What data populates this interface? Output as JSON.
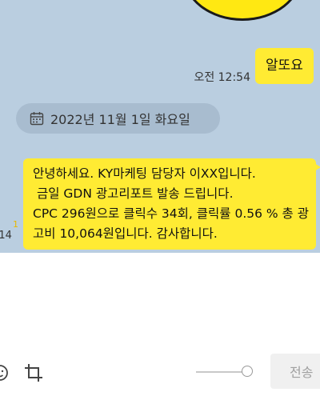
{
  "chat": {
    "messages": [
      {
        "time": "오전 12:54",
        "text": "알또요"
      },
      {
        "unread": "1",
        "time": ":14",
        "text": "안녕하세요. KY마케팅 담당자 이XX입니다.\n 금일 GDN 광고리포트 발송 드립니다.\nCPC 296원으로 클릭수 34회, 클릭률 0.56 % 총 광고비 10,064원입니다. 감사합니다."
      }
    ],
    "date_divider": "2022년 11월 1일 화요일"
  },
  "composer": {
    "send_label": "전송"
  },
  "colors": {
    "chat_background": "#bacee0",
    "bubble": "#ffeb33",
    "date_pill": "#a8bccf",
    "unread": "#e8b800"
  },
  "icons": {
    "sticker": "sticker-image",
    "date": "calendar-icon",
    "toolbar": [
      "emoji-icon",
      "crop-icon"
    ]
  }
}
